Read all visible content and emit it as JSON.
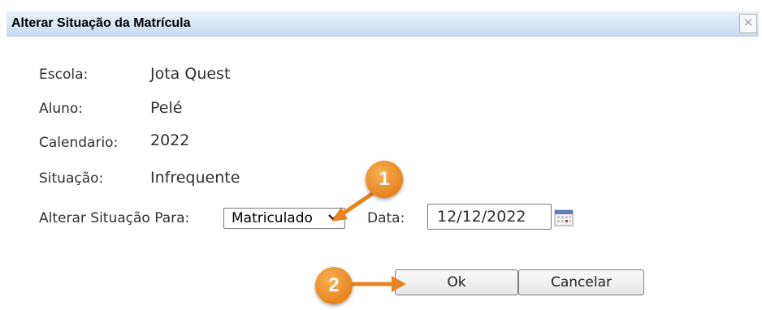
{
  "dialog": {
    "title": "Alterar Situação da Matrícula",
    "close_icon": "close-icon"
  },
  "fields": [
    {
      "label": "Escola:",
      "value": "Jota Quest"
    },
    {
      "label": "Aluno:",
      "value": "Pelé"
    },
    {
      "label": "Calendario:",
      "value": "2022"
    },
    {
      "label": "Situação:",
      "value": "Infrequente"
    }
  ],
  "change": {
    "label": "Alterar Situação Para:",
    "selected": "Matriculado",
    "date_label": "Data:",
    "date_value": "12/12/2022",
    "calendar_icon": "calendar-icon"
  },
  "buttons": {
    "ok": "Ok",
    "cancel": "Cancelar"
  },
  "annotations": [
    {
      "number": "1"
    },
    {
      "number": "2"
    }
  ],
  "colors": {
    "titlebar": "#c9dcf3",
    "badge": "#e8841f"
  }
}
